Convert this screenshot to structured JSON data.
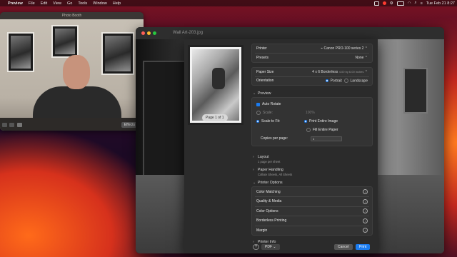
{
  "menubar": {
    "app": "Preview",
    "items": [
      "File",
      "Edit",
      "View",
      "Go",
      "Tools",
      "Window",
      "Help"
    ],
    "clock": "Tue Feb 21  8:27"
  },
  "photobooth": {
    "title": "Photo Booth",
    "effects_label": "Effects"
  },
  "preview": {
    "title": "Wall Art-203.jpg"
  },
  "print": {
    "page_label": "Page 1 of 1",
    "printer_label": "Printer",
    "printer_value": "Canon PRO-100 series 2",
    "presets_label": "Presets",
    "presets_value": "None",
    "paper_size_label": "Paper Size",
    "paper_size_value": "4 x 6 Borderless",
    "paper_size_dims": "4.00 by 6.00 inches",
    "orientation_label": "Orientation",
    "portrait": "Portrait",
    "landscape": "Landscape",
    "preview_section": "Preview",
    "auto_rotate": "Auto Rotate",
    "scale": "Scale:",
    "scale_value": "100%",
    "scale_to_fit": "Scale to Fit:",
    "print_entire_image": "Print Entire Image",
    "fill_entire_paper": "Fill Entire Paper",
    "copies_label": "Copies per page:",
    "copies_value": "1",
    "layout": "Layout",
    "layout_sub": "1 page per sheet",
    "paper_handling": "Paper Handling",
    "paper_handling_sub": "Collate Sheets, All Sheets",
    "printer_options": "Printer Options",
    "options": [
      "Color Matching",
      "Quality & Media",
      "Color Options",
      "Borderless Printing",
      "Margin"
    ],
    "printer_info": "Printer Info",
    "pdf": "PDF",
    "cancel": "Cancel",
    "print": "Print"
  }
}
